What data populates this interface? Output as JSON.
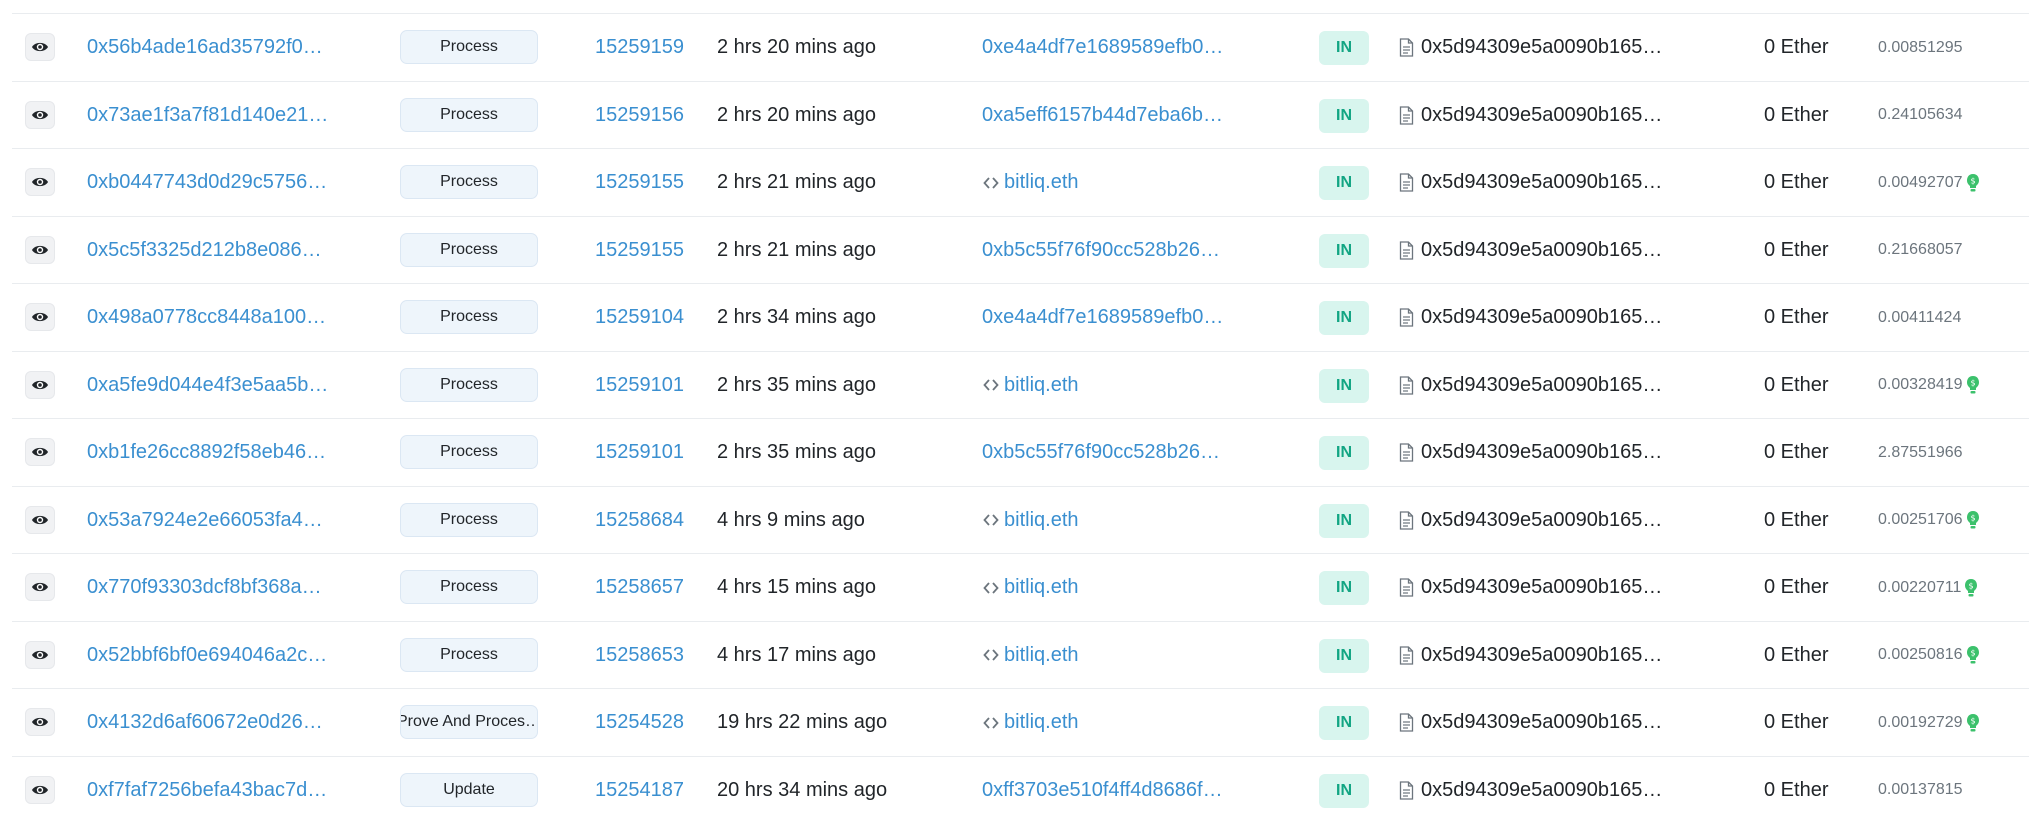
{
  "colors": {
    "link": "#3a8fd0",
    "in_badge_bg": "#d8f5ee",
    "in_badge_text": "#12a583",
    "method_bg": "#eef5fb",
    "gas_icon": "#3cc16c"
  },
  "icons": {
    "view": "eye-icon",
    "contract": "contract-code-icon",
    "to_contract": "document-icon",
    "fee": "gas-station-icon"
  },
  "rows": [
    {
      "txhash": "0x56b4ade16ad35792f0…",
      "method": "Process",
      "block": "15259159",
      "age": "2 hrs 20 mins ago",
      "from": "0xe4a4df7e1689589efb0…",
      "from_is_contract": false,
      "direction": "IN",
      "to": "0x5d94309e5a0090b165…",
      "value": "0 Ether",
      "fee": "0.00851295",
      "gas_icon": false
    },
    {
      "txhash": "0x73ae1f3a7f81d140e21…",
      "method": "Process",
      "block": "15259156",
      "age": "2 hrs 20 mins ago",
      "from": "0xa5eff6157b44d7eba6b…",
      "from_is_contract": false,
      "direction": "IN",
      "to": "0x5d94309e5a0090b165…",
      "value": "0 Ether",
      "fee": "0.24105634",
      "gas_icon": false
    },
    {
      "txhash": "0xb0447743d0d29c5756…",
      "method": "Process",
      "block": "15259155",
      "age": "2 hrs 21 mins ago",
      "from": "bitliq.eth",
      "from_is_contract": true,
      "direction": "IN",
      "to": "0x5d94309e5a0090b165…",
      "value": "0 Ether",
      "fee": "0.00492707",
      "gas_icon": true
    },
    {
      "txhash": "0x5c5f3325d212b8e086…",
      "method": "Process",
      "block": "15259155",
      "age": "2 hrs 21 mins ago",
      "from": "0xb5c55f76f90cc528b26…",
      "from_is_contract": false,
      "direction": "IN",
      "to": "0x5d94309e5a0090b165…",
      "value": "0 Ether",
      "fee": "0.21668057",
      "gas_icon": false
    },
    {
      "txhash": "0x498a0778cc8448a100…",
      "method": "Process",
      "block": "15259104",
      "age": "2 hrs 34 mins ago",
      "from": "0xe4a4df7e1689589efb0…",
      "from_is_contract": false,
      "direction": "IN",
      "to": "0x5d94309e5a0090b165…",
      "value": "0 Ether",
      "fee": "0.00411424",
      "gas_icon": false
    },
    {
      "txhash": "0xa5fe9d044e4f3e5aa5b…",
      "method": "Process",
      "block": "15259101",
      "age": "2 hrs 35 mins ago",
      "from": "bitliq.eth",
      "from_is_contract": true,
      "direction": "IN",
      "to": "0x5d94309e5a0090b165…",
      "value": "0 Ether",
      "fee": "0.00328419",
      "gas_icon": true
    },
    {
      "txhash": "0xb1fe26cc8892f58eb46…",
      "method": "Process",
      "block": "15259101",
      "age": "2 hrs 35 mins ago",
      "from": "0xb5c55f76f90cc528b26…",
      "from_is_contract": false,
      "direction": "IN",
      "to": "0x5d94309e5a0090b165…",
      "value": "0 Ether",
      "fee": "2.87551966",
      "gas_icon": false
    },
    {
      "txhash": "0x53a7924e2e66053fa4…",
      "method": "Process",
      "block": "15258684",
      "age": "4 hrs 9 mins ago",
      "from": "bitliq.eth",
      "from_is_contract": true,
      "direction": "IN",
      "to": "0x5d94309e5a0090b165…",
      "value": "0 Ether",
      "fee": "0.00251706",
      "gas_icon": true
    },
    {
      "txhash": "0x770f93303dcf8bf368a…",
      "method": "Process",
      "block": "15258657",
      "age": "4 hrs 15 mins ago",
      "from": "bitliq.eth",
      "from_is_contract": true,
      "direction": "IN",
      "to": "0x5d94309e5a0090b165…",
      "value": "0 Ether",
      "fee": "0.00220711",
      "gas_icon": true
    },
    {
      "txhash": "0x52bbf6bf0e694046a2c…",
      "method": "Process",
      "block": "15258653",
      "age": "4 hrs 17 mins ago",
      "from": "bitliq.eth",
      "from_is_contract": true,
      "direction": "IN",
      "to": "0x5d94309e5a0090b165…",
      "value": "0 Ether",
      "fee": "0.00250816",
      "gas_icon": true
    },
    {
      "txhash": "0x4132d6af60672e0d26…",
      "method": "Prove And Proces…",
      "block": "15254528",
      "age": "19 hrs 22 mins ago",
      "from": "bitliq.eth",
      "from_is_contract": true,
      "direction": "IN",
      "to": "0x5d94309e5a0090b165…",
      "value": "0 Ether",
      "fee": "0.00192729",
      "gas_icon": true
    },
    {
      "txhash": "0xf7faf7256befa43bac7d…",
      "method": "Update",
      "block": "15254187",
      "age": "20 hrs 34 mins ago",
      "from": "0xff3703e510f4ff4d8686f…",
      "from_is_contract": false,
      "direction": "IN",
      "to": "0x5d94309e5a0090b165…",
      "value": "0 Ether",
      "fee": "0.00137815",
      "gas_icon": false
    }
  ]
}
